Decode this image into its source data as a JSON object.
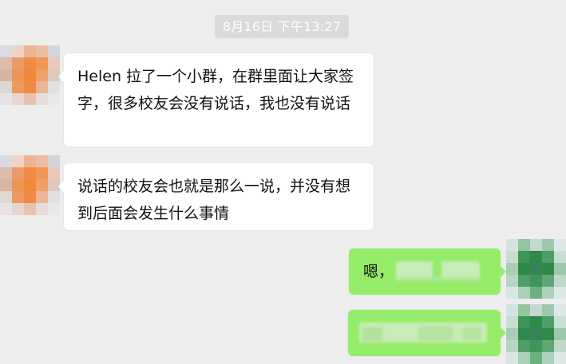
{
  "chat": {
    "timestamp": "8月16日 下午13:27",
    "messages": [
      {
        "sender": "other",
        "text": "Helen 拉了一个小群，在群里面让大家签字，很多校友会没有说话，我也没有说话"
      },
      {
        "sender": "other",
        "text": "说话的校友会也就是那么一说，并没有想到后面会发生什么事情"
      },
      {
        "sender": "me",
        "text": "嗯，"
      }
    ]
  },
  "colors": {
    "background": "#ededed",
    "received_bubble": "#ffffff",
    "sent_bubble": "#95ec69",
    "timestamp_bg": "#dadada",
    "timestamp_text": "#ffffff"
  }
}
